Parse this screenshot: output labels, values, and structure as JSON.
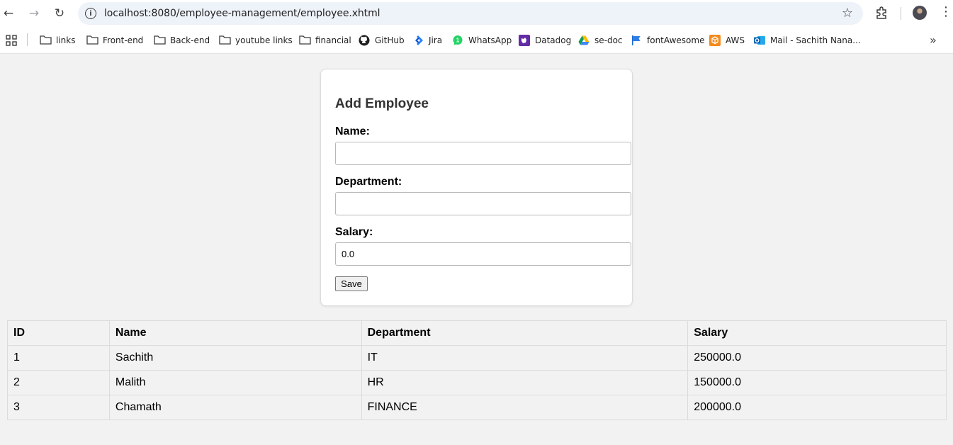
{
  "browser": {
    "url": "localhost:8080/employee-management/employee.xhtml",
    "bookmarks": [
      {
        "label": "links",
        "icon": "folder-icon"
      },
      {
        "label": "Front-end",
        "icon": "folder-icon"
      },
      {
        "label": "Back-end",
        "icon": "folder-icon"
      },
      {
        "label": "youtube links",
        "icon": "folder-icon"
      },
      {
        "label": "financial",
        "icon": "folder-icon"
      },
      {
        "label": "GitHub",
        "icon": "github-icon"
      },
      {
        "label": "Jira",
        "icon": "jira-icon"
      },
      {
        "label": "WhatsApp",
        "icon": "whatsapp-icon"
      },
      {
        "label": "Datadog",
        "icon": "datadog-icon"
      },
      {
        "label": "se-doc",
        "icon": "google-drive-icon"
      },
      {
        "label": "fontAwesome",
        "icon": "flag-icon"
      },
      {
        "label": "AWS",
        "icon": "aws-icon"
      },
      {
        "label": "Mail - Sachith Nana...",
        "icon": "outlook-icon"
      }
    ]
  },
  "form": {
    "title": "Add Employee",
    "name_label": "Name:",
    "name_value": "",
    "department_label": "Department:",
    "department_value": "",
    "salary_label": "Salary:",
    "salary_value": "0.0",
    "save_label": "Save"
  },
  "table": {
    "headers": [
      "ID",
      "Name",
      "Department",
      "Salary"
    ],
    "rows": [
      [
        "1",
        "Sachith",
        "IT",
        "250000.0"
      ],
      [
        "2",
        "Malith",
        "HR",
        "150000.0"
      ],
      [
        "3",
        "Chamath",
        "FINANCE",
        "200000.0"
      ]
    ]
  },
  "colors": {
    "page_bg": "#f2f2f2",
    "card_bg": "#ffffff",
    "omnibox_bg": "#eef2f9"
  }
}
